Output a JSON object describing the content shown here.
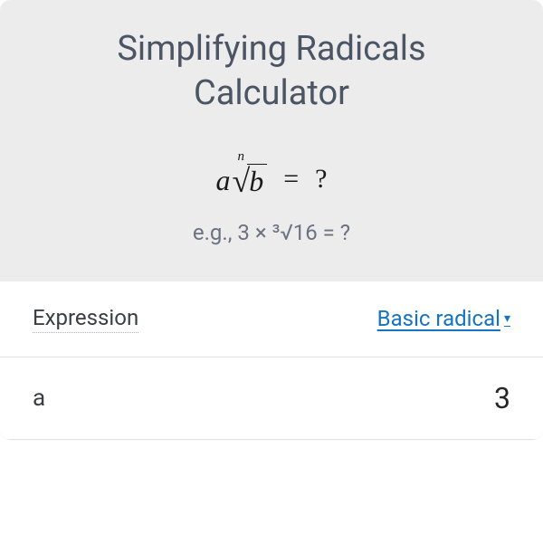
{
  "header": {
    "title": "Simplifying Radicals Calculator"
  },
  "formula": {
    "a": "a",
    "n": "n",
    "b": "b",
    "equals": "=",
    "question": "?",
    "example": "e.g., 3 × ³√16 = ?"
  },
  "rows": {
    "expression": {
      "label": "Expression",
      "dropdown": "Basic radical",
      "arrow": "▾"
    },
    "a": {
      "label": "a",
      "value": "3"
    }
  }
}
